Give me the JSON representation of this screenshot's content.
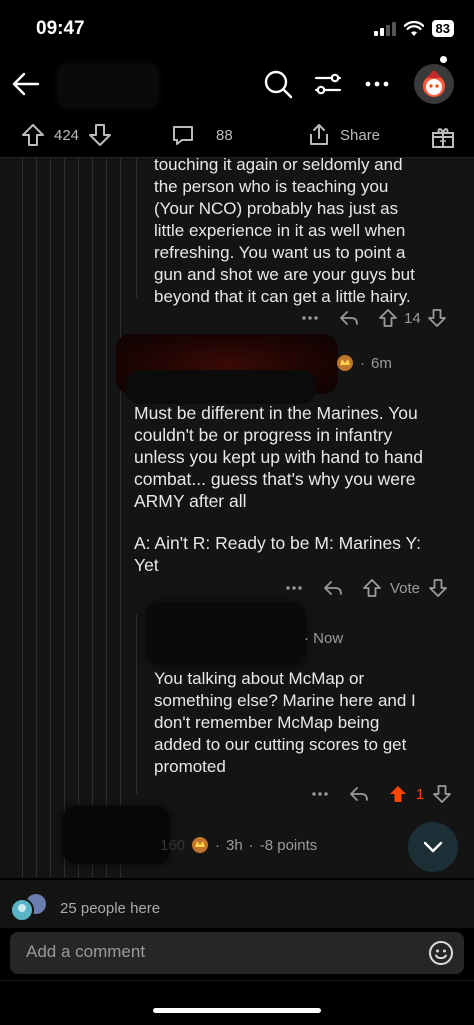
{
  "status": {
    "time": "09:47",
    "battery": "83"
  },
  "post_actions": {
    "upvotes": "424",
    "comments": "88",
    "share_label": "Share"
  },
  "comments": [
    {
      "lines": [
        "touching it again or seldomly and",
        "the person who is teaching you",
        "(Your NCO) probably has just as",
        "little experience in it as well when",
        "refreshing. You want us to point a",
        "gun and shot we are your guys but",
        "beyond that it can get a little hairy."
      ],
      "votes": "14"
    },
    {
      "time": "6m",
      "paragraph1": [
        "Must be different in the Marines.  You",
        "couldn't be or progress in infantry",
        "unless you kept up with hand to hand",
        "combat... guess that's why you were",
        "ARMY after all"
      ],
      "paragraph2": [
        "A: Ain't R: Ready to be M: Marines Y:",
        "Yet"
      ],
      "vote_label": "Vote"
    },
    {
      "time": "Now",
      "lines": [
        "You talking about McMap or",
        "something else? Marine here and I",
        "don't remember McMap being",
        "added to our cutting scores to get",
        "promoted"
      ],
      "votes": "1"
    },
    {
      "user_fragment": "160",
      "time": "3h",
      "points": "-8 points"
    }
  ],
  "presence": {
    "text": "25 people here"
  },
  "composer": {
    "placeholder": "Add a comment"
  },
  "colors": {
    "upvote_active": "#ff4500",
    "background": "#141414"
  }
}
